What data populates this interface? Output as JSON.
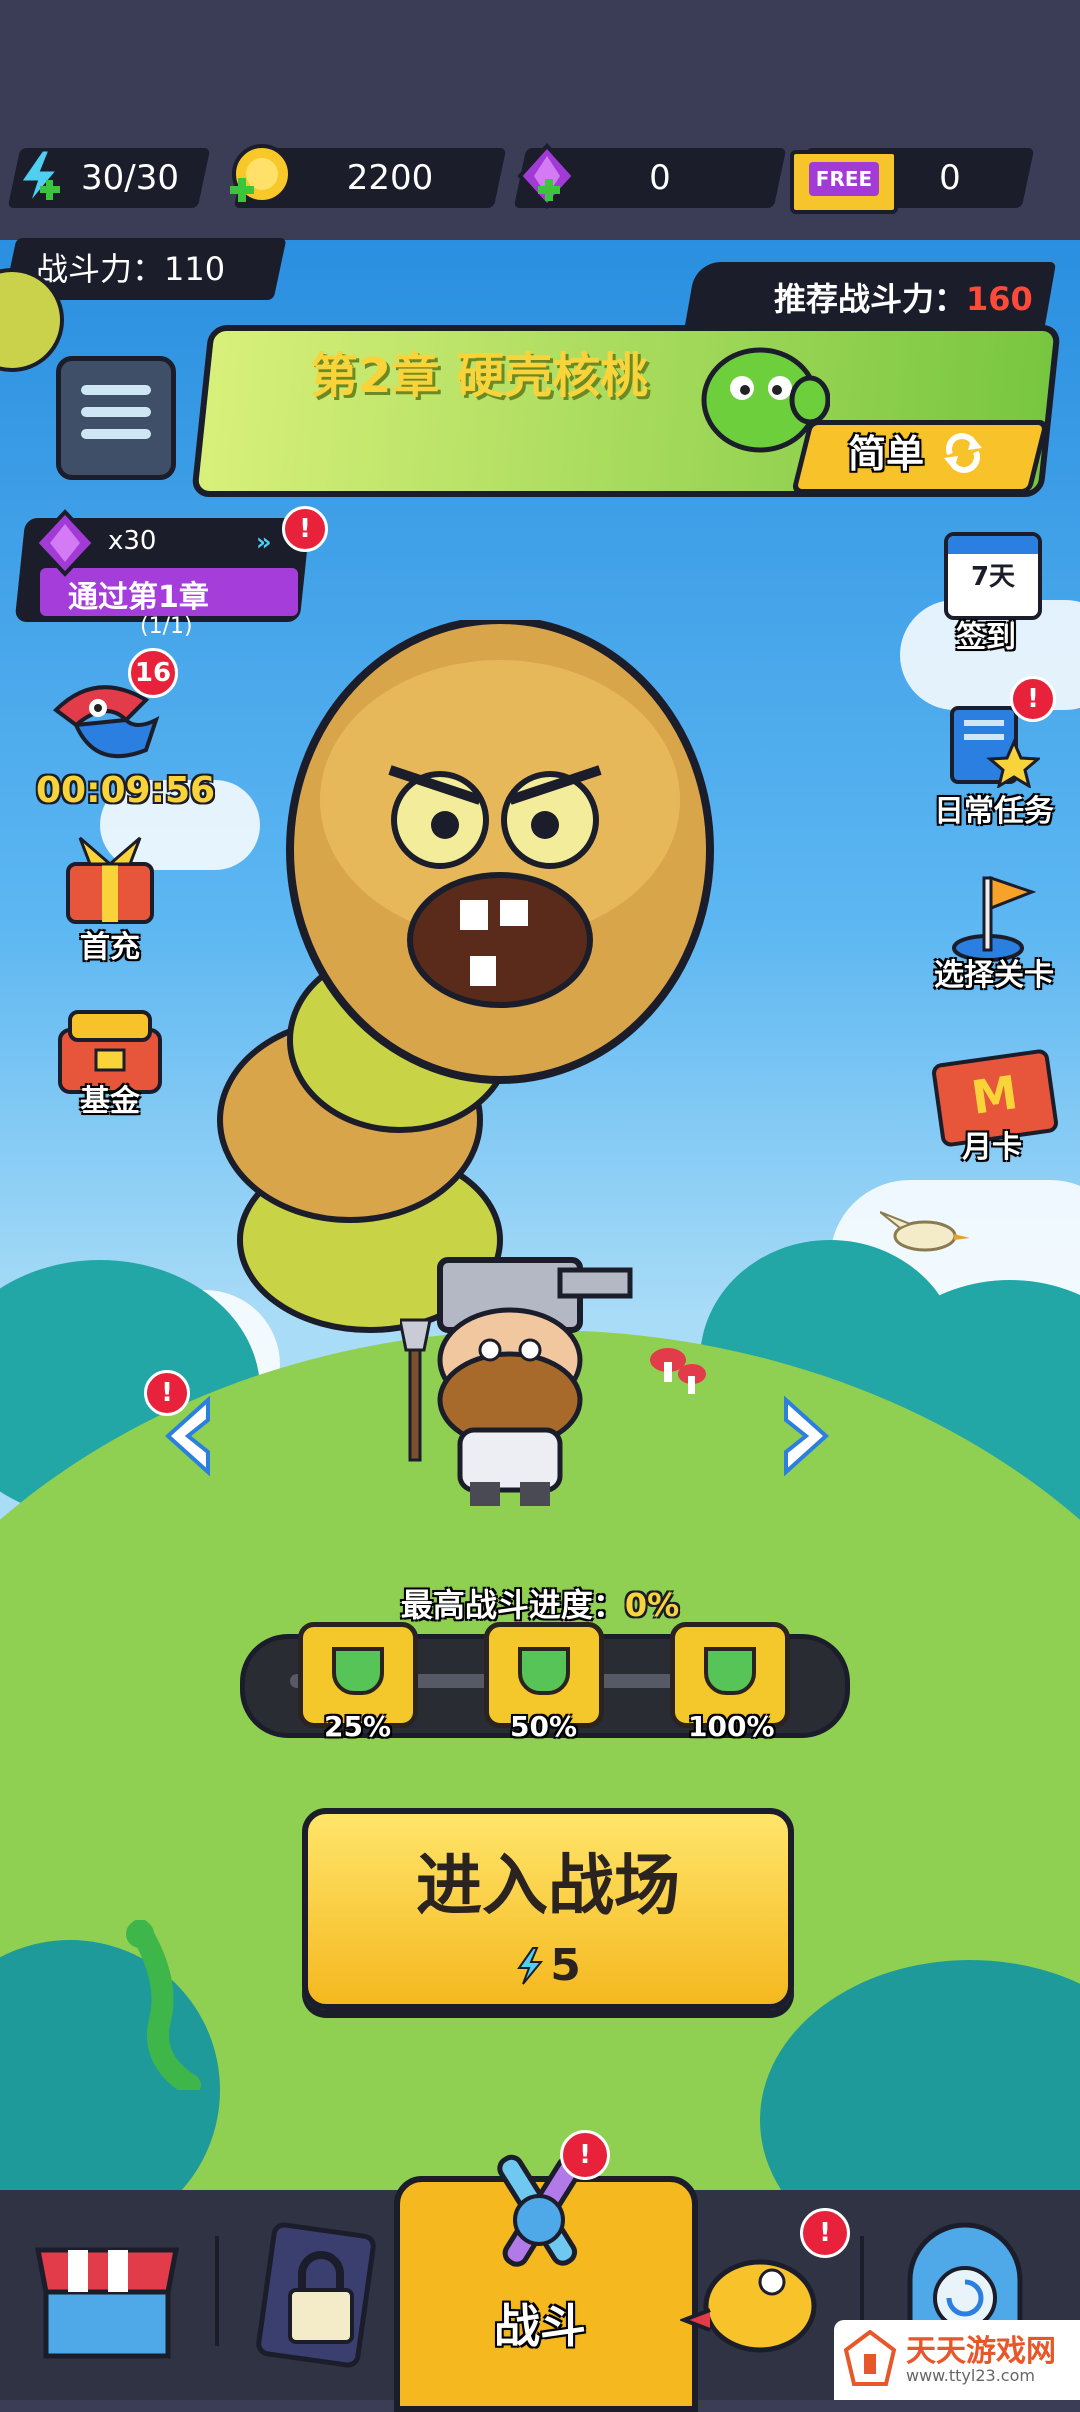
{
  "resources": {
    "energy": "30/30",
    "gold": "2200",
    "gems": "0",
    "free_tickets": "0",
    "free_label": "FREE"
  },
  "power": {
    "label": "战斗力：110",
    "recommended_label": "推荐战斗力：",
    "recommended_value": "160"
  },
  "chapter": {
    "title": "第2章  硬壳核桃",
    "difficulty": "简单"
  },
  "quest": {
    "reward": "x30",
    "title": "通过第1章",
    "progress": "(1/1)"
  },
  "left_buttons": {
    "event_badge": "16",
    "event_timer": "00:09:56",
    "first_recharge": "首充",
    "fund": "基金"
  },
  "right_buttons": {
    "checkin_days": "7天",
    "checkin": "签到",
    "daily_tasks": "日常任务",
    "select_level": "选择关卡",
    "monthly_card": "月卡",
    "monthly_card_letter": "M"
  },
  "progress": {
    "label": "最高战斗进度：",
    "value": "0%",
    "milestones": [
      "25%",
      "50%",
      "100%"
    ]
  },
  "enter": {
    "label": "进入战场",
    "cost": "5"
  },
  "nav": {
    "battle": "战斗"
  },
  "watermark": {
    "name": "天天游戏网",
    "url": "www.ttyl23.com"
  },
  "colors": {
    "accent_yellow": "#f8d33a",
    "danger": "#e8223b",
    "purple": "#a23bd6"
  }
}
